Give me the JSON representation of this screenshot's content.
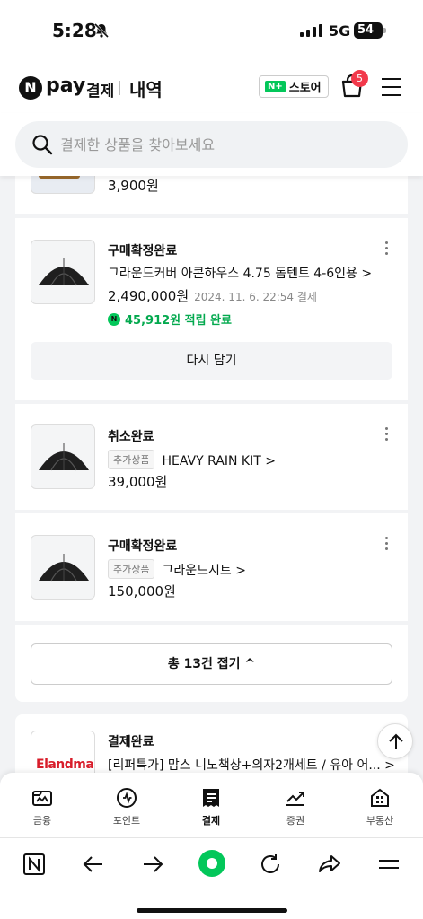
{
  "status_bar": {
    "time": "5:28",
    "network": "5G",
    "battery": "54"
  },
  "header": {
    "logo_letter": "N",
    "logo_text": "pay",
    "pay_label": "결제",
    "history_label": "내역",
    "store_badge": "N+",
    "store_label": "스토어",
    "cart_count": "5"
  },
  "search": {
    "placeholder": "결제한 상품을 찾아보세요"
  },
  "orders": [
    {
      "price": "3,900원"
    },
    {
      "status": "구매확정완료",
      "name": "그라운드커버 아콘하우스 4.75 돔텐트 4-6인용 >",
      "price": "2,490,000원",
      "date": "2024. 11. 6. 22:54 결제",
      "point": "45,912원 적립 완료",
      "point_icon": "N",
      "action": "다시 담기"
    },
    {
      "status": "취소완료",
      "tag": "추가상품",
      "name": "HEAVY RAIN KIT >",
      "price": "39,000원"
    },
    {
      "status": "구매확정완료",
      "tag": "추가상품",
      "name": "그라운드시트 >",
      "price": "150,000원"
    },
    {
      "status": "결제완료",
      "brand": "Elandmall",
      "name": "[리퍼특가] 맘스 니노책상+의자2개세트 / 유아 어... >"
    }
  ],
  "collapse_label": "총 13건 접기 ^",
  "tabs": [
    {
      "label": "금융",
      "icon": "finance-icon"
    },
    {
      "label": "포인트",
      "icon": "point-icon"
    },
    {
      "label": "결제",
      "icon": "receipt-icon"
    },
    {
      "label": "증권",
      "icon": "stock-chart-icon"
    },
    {
      "label": "부동산",
      "icon": "building-icon"
    }
  ],
  "colors": {
    "brand_green": "#03c75a",
    "point_green": "#03a94e",
    "badge_red": "#f2394b",
    "elandmall_red": "#d81d2a"
  }
}
